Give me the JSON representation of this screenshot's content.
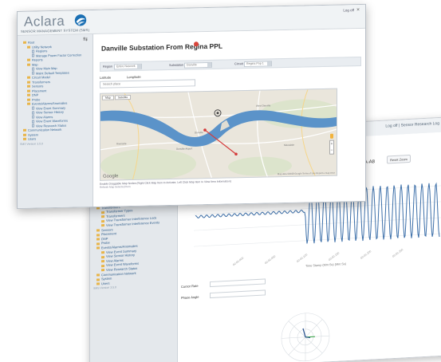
{
  "colors": {
    "brand_blue": "#1a6fb3",
    "river": "#5b93c9",
    "map_land": "#eae6dc",
    "route": "#d43b3b",
    "wave": "#3b6ea8",
    "marker": "#d9443a",
    "polar_green": "#3da64b",
    "polar_blue": "#244e8d"
  },
  "header": {
    "logo_text": "Aclara",
    "product_name": "SENSOR MANAGEMENT SYSTEM (SMS)",
    "user_link": "Log off"
  },
  "sidebar": {
    "collapse_icon": "pin-icon",
    "tree": [
      {
        "level": 1,
        "label": "Root"
      },
      {
        "level": 2,
        "label": "Utility Network"
      },
      {
        "level": 3,
        "label": "Regions"
      },
      {
        "level": 3,
        "label": "Manage Power Factor Correction"
      },
      {
        "level": 2,
        "label": "Reports"
      },
      {
        "level": 2,
        "label": "Map"
      },
      {
        "level": 3,
        "label": "View Main Map"
      },
      {
        "level": 3,
        "label": "Maint Default Templates"
      },
      {
        "level": 2,
        "label": "Circuit Model"
      },
      {
        "level": 2,
        "label": "Transformers"
      },
      {
        "level": 2,
        "label": "Sensors"
      },
      {
        "level": 2,
        "label": "Placement"
      },
      {
        "level": 2,
        "label": "DNP"
      },
      {
        "level": 2,
        "label": "Probe"
      },
      {
        "level": 2,
        "label": "Events/Alarms/Anomalies"
      },
      {
        "level": 3,
        "label": "View Event Summary"
      },
      {
        "level": 3,
        "label": "View Sensor History"
      },
      {
        "level": 3,
        "label": "View Alarms"
      },
      {
        "level": 3,
        "label": "View Event Waveforms"
      },
      {
        "level": 3,
        "label": "View Research Status"
      },
      {
        "level": 1,
        "label": "Communication Network"
      },
      {
        "level": 1,
        "label": "System"
      },
      {
        "level": 1,
        "label": "Users"
      }
    ],
    "footer": "SMS Version 3.5.0"
  },
  "main": {
    "title": "Danville Substation From Regina PPL",
    "filters": {
      "region_label": "Region",
      "region_value": "Entire Network",
      "substation_label": "Substation",
      "substation_value": "Danville",
      "circuit_label": "Circuit",
      "circuit_value": "Regina Pop 1"
    },
    "latitude_label": "Latitude",
    "longitude_label": "Longitude",
    "search_placeholder": "Search place",
    "map_tabs": [
      "Map",
      "Satellite"
    ],
    "map_footer": "Map data ©2018 Google   Terms of Use   Report a map error",
    "google_label": "Google",
    "map_note": "Enable Draggable Map Nodes (Right Click Map Item to Activate, Left Click Map Item to View Item Information)",
    "map_note2": "Refresh Map Selected Item"
  },
  "rear": {
    "topbar_text": "Log off  |  Sensor Research Log",
    "title": "69-A-A8",
    "reset_zoom": "Reset Zoom",
    "chart_caption": "Time Stamp (Mm:Ss) (Mm:Ss)",
    "cursor_label": "Cursor Rate",
    "phase_label": "Phase Angle",
    "tree": [
      {
        "level": 1,
        "label": "Circuit Model"
      },
      {
        "level": 1,
        "label": "Transformers"
      },
      {
        "level": 2,
        "label": "Transformer Types"
      },
      {
        "level": 2,
        "label": "Transformers"
      },
      {
        "level": 2,
        "label": "View Transformer Interference Lock"
      },
      {
        "level": 2,
        "label": "View Transformer Interference Events"
      },
      {
        "level": 1,
        "label": "Sensors"
      },
      {
        "level": 1,
        "label": "Placement"
      },
      {
        "level": 1,
        "label": "DNP"
      },
      {
        "level": 1,
        "label": "Probe"
      },
      {
        "level": 1,
        "label": "Events/Alarms/Anomalies"
      },
      {
        "level": 2,
        "label": "View Event Summary"
      },
      {
        "level": 2,
        "label": "View Sensor History"
      },
      {
        "level": 2,
        "label": "View Alarms"
      },
      {
        "level": 2,
        "label": "View Event Waveforms"
      },
      {
        "level": 2,
        "label": "View Research Status"
      },
      {
        "level": 1,
        "label": "Communication Network"
      },
      {
        "level": 1,
        "label": "System"
      },
      {
        "level": 1,
        "label": "Users"
      }
    ],
    "tree_footer": "SMS Version 3.5.0"
  }
}
